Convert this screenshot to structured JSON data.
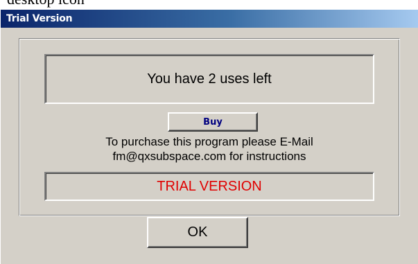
{
  "background": {
    "text": "desktop icon"
  },
  "window": {
    "title": "Trial Version",
    "uses_message": "You have 2 uses left",
    "buy_label": "Buy",
    "instructions_line1": "To purchase this program please  E-Mail",
    "instructions_line2": "fm@qxsubspace.com for instructions",
    "trial_banner": "TRIAL VERSION",
    "ok_label": "OK"
  },
  "colors": {
    "titlebar_start": "#0a246a",
    "titlebar_end": "#a6caf0",
    "face": "#d4d0c8",
    "trial_text": "#e00000",
    "buy_text": "#000080"
  }
}
